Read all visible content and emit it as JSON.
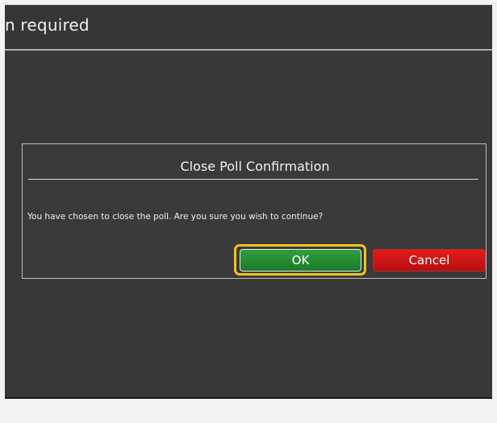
{
  "window": {
    "title": "n required"
  },
  "dialog": {
    "title": "Close Poll Confirmation",
    "message": "You have chosen to close the poll. Are you sure you wish to continue?",
    "ok_label": "OK",
    "cancel_label": "Cancel"
  },
  "colors": {
    "background": "#383838",
    "ok": "#2a8f37",
    "cancel": "#d21616",
    "highlight": "#f2c21c"
  }
}
